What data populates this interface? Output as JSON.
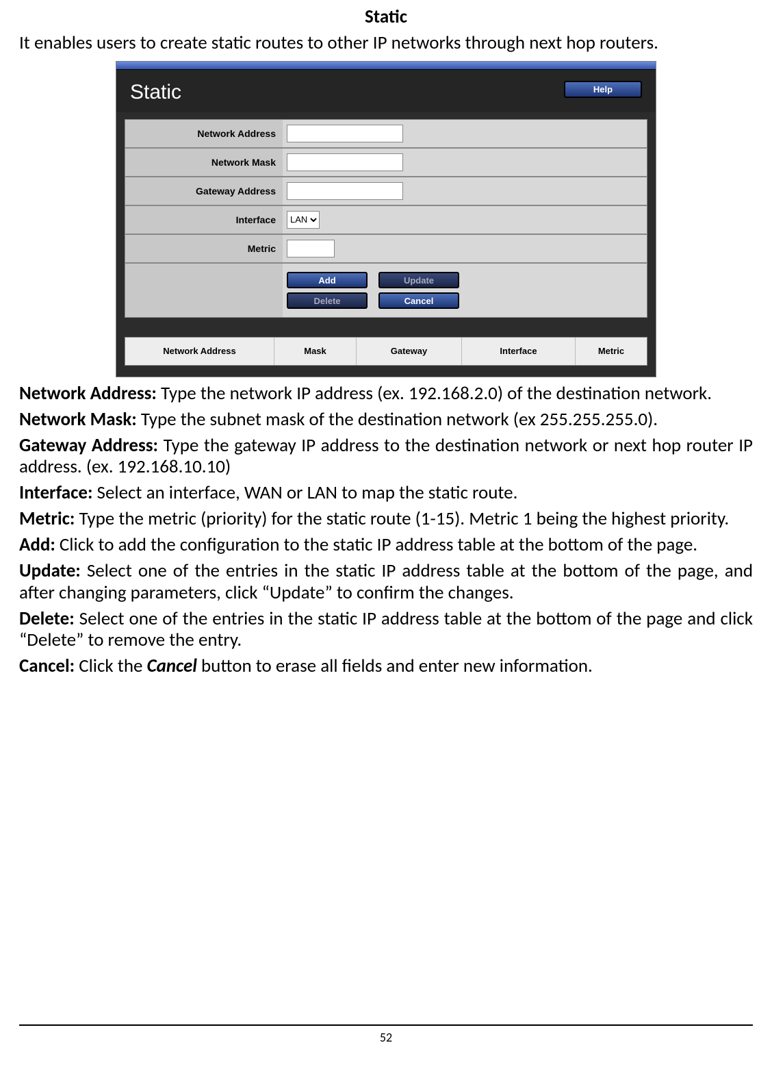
{
  "doc": {
    "title": "Static",
    "intro": "It enables users to create static routes to other IP networks through next hop routers.",
    "page_number": "52"
  },
  "ui": {
    "header_title": "Static",
    "help": "Help",
    "fields": {
      "network_address": "Network Address",
      "network_mask": "Network Mask",
      "gateway_address": "Gateway Address",
      "interface": "Interface",
      "metric": "Metric"
    },
    "interface_value": "LAN",
    "buttons": {
      "add": "Add",
      "update": "Update",
      "delete": "Delete",
      "cancel": "Cancel"
    },
    "table_headers": {
      "network_address": "Network Address",
      "mask": "Mask",
      "gateway": "Gateway",
      "interface": "Interface",
      "metric": "Metric"
    }
  },
  "defs": {
    "na_label": "Network Address:",
    "na_text": " Type the network IP address (ex. 192.168.2.0) of the destination network.",
    "nm_label": "Network Mask:",
    "nm_text": " Type the subnet mask of the destination network (ex 255.255.255.0).",
    "ga_label": "Gateway Address:",
    "ga_text": " Type the gateway IP address to the destination network or next hop router IP address. (ex. 192.168.10.10)",
    "if_label": "Interface:",
    "if_text": " Select an interface, WAN or LAN to map the static route.",
    "me_label": "Metric:",
    "me_text": " Type the metric (priority) for the static route (1-15). Metric 1 being the highest priority.",
    "add_label": "Add:",
    "add_text": " Click to add the configuration to the static IP address table at the bottom of the page.",
    "up_label": "Update:",
    "up_text": " Select one of the entries in the static IP address table at the bottom of the page, and after changing parameters, click “Update” to confirm the changes.",
    "del_label": "Delete:",
    "del_text": " Select one of the entries in the static IP address table at the bottom of the page and click “Delete” to remove the entry.",
    "can_label": "Cancel:",
    "can_text_1": " Click the ",
    "can_text_em": "Cancel",
    "can_text_2": " button to erase all fields and enter new information."
  }
}
